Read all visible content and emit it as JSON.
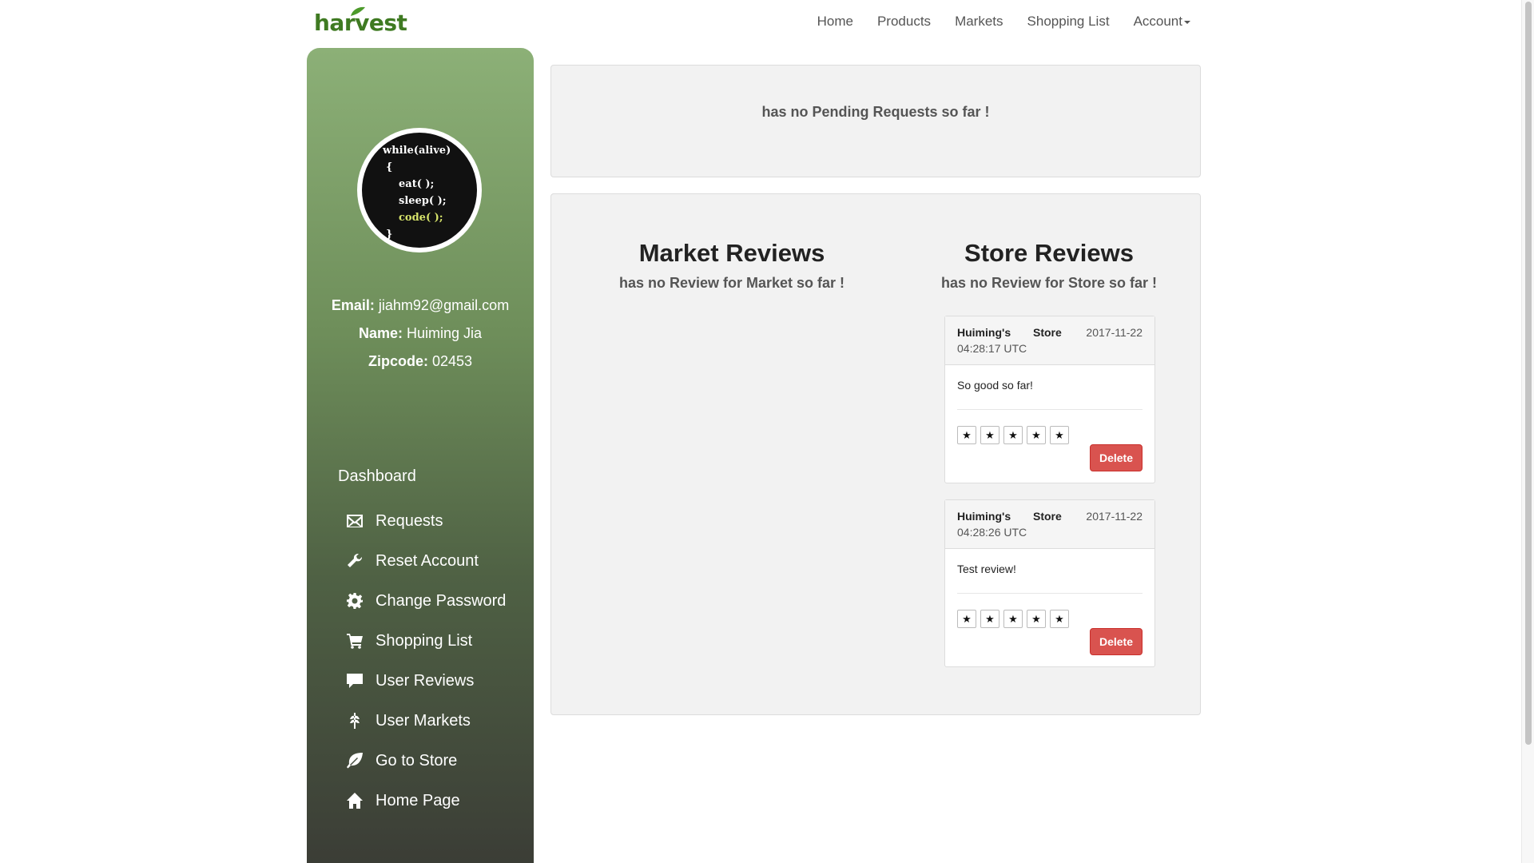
{
  "brand": {
    "logo_text": "harvest"
  },
  "nav": {
    "items": [
      "Home",
      "Products",
      "Markets",
      "Shopping List"
    ],
    "account": "Account"
  },
  "profile": {
    "avatar_code": [
      "while(alive)",
      "{",
      "eat( );",
      "sleep( );",
      "code( );",
      "}"
    ],
    "email_label": "Email:",
    "email": "jiahm92@gmail.com",
    "name_label": "Name:",
    "name": "Huiming Jia",
    "zip_label": "Zipcode:",
    "zip": "02453"
  },
  "sidebar": {
    "title": "Dashboard",
    "items": [
      {
        "label": "Requests",
        "icon": "envelope-icon"
      },
      {
        "label": "Reset Account",
        "icon": "wrench-icon"
      },
      {
        "label": "Change Password",
        "icon": "gear-icon"
      },
      {
        "label": "Shopping List",
        "icon": "cart-icon"
      },
      {
        "label": "User Reviews",
        "icon": "comment-icon"
      },
      {
        "label": "User Markets",
        "icon": "grain-icon"
      },
      {
        "label": "Go to Store",
        "icon": "leaf-icon"
      },
      {
        "label": "Home Page",
        "icon": "home-icon"
      }
    ]
  },
  "pending": {
    "text": "has no Pending Requests so far !"
  },
  "market_reviews": {
    "title": "Market Reviews",
    "empty": "has no Review for Market so far !"
  },
  "store_reviews": {
    "title": "Store Reviews",
    "empty": "has no Review for Store so far !",
    "cards": [
      {
        "name": "Huiming's",
        "store": "Store",
        "date": "2017-11-22",
        "time": "04:28:17 UTC",
        "text": "So good so far!",
        "stars": 5,
        "delete": "Delete"
      },
      {
        "name": "Huiming's",
        "store": "Store",
        "date": "2017-11-22",
        "time": "04:28:26 UTC",
        "text": "Test review!",
        "stars": 5,
        "delete": "Delete"
      }
    ]
  },
  "colors": {
    "brand_green": "#3f7a22",
    "delete_red": "#d9534f",
    "sidebar_top": "#8cb077",
    "sidebar_bottom": "#3b3d36"
  }
}
